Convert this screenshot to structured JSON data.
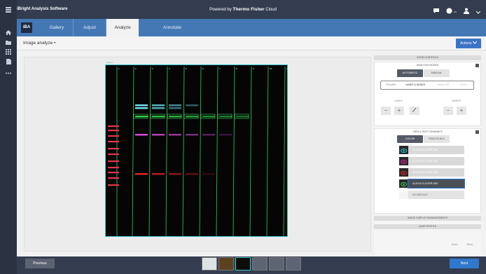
{
  "app": {
    "name": "iBright Analysis Software",
    "powered_prefix": "Powered by",
    "powered_brand": "Thermo Fisher",
    "powered_suffix": "Cloud",
    "user_initials": "us"
  },
  "tabs": {
    "logo": "iBA",
    "items": [
      "Gallery",
      "Adjust",
      "Analyze",
      "Annotate"
    ],
    "active": "Analyze"
  },
  "header": {
    "title": "Image analyze •",
    "actions_label": "Actions"
  },
  "gel": {
    "label": "Image 1",
    "lane_count": 11,
    "lane_numbers": [
      "1",
      "2",
      "3",
      "4",
      "5",
      "6",
      "7",
      "8",
      "9",
      "10",
      "11"
    ]
  },
  "panel": {
    "zoom_controls": "ZOOM CONTROLS",
    "analysis_modes": "ANALYSIS MODES",
    "automatic": "AUTOMATIC",
    "manual": "MANUAL",
    "sub_tabs": [
      "FRAMES",
      "LANES & BANDS",
      "ANALYSE",
      "DATA"
    ],
    "lanes_label": "LANES",
    "bands_label": "BANDS",
    "view_edit": "VIEW & EDIT CHANNELS",
    "color": "COLOR",
    "grayscale": "GRAYSCALE",
    "channels": [
      "ALEXA FLUOR® 488",
      "ALEXA FLUOR® 546",
      "ALEXA FLUOR® 680",
      "ALEXA FLUOR® 800",
      "MEMBRANE"
    ],
    "channel_colors": [
      "#21c9cf",
      "#e0219c",
      "#e12121",
      "#2ecf4a",
      "#dddddd"
    ],
    "image_display": "IMAGE DISPLAY ENHANCEMENTS",
    "lane_profile": "LANE PROFILE",
    "undo": "Undo",
    "redo": "Redo"
  },
  "footer": {
    "previous": "Previous",
    "next": "Next"
  },
  "colors": {
    "topbar": "#333d4f",
    "tabbar": "#4478b5",
    "accent": "#2f78cc",
    "gel_border": "#39c6c6"
  }
}
